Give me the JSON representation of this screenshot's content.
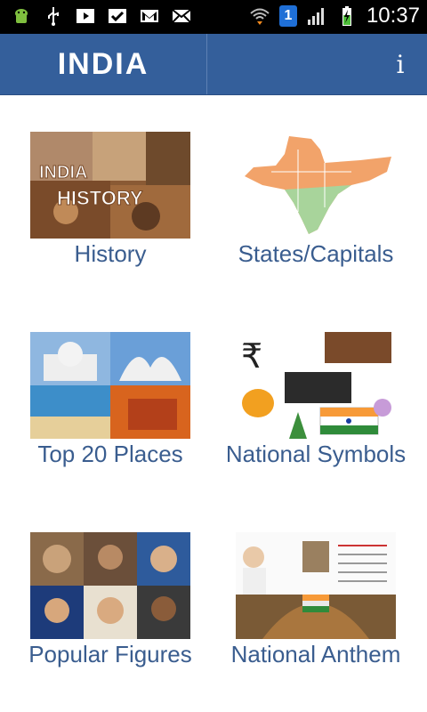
{
  "status_bar": {
    "time": "10:37",
    "sim_slot": "1",
    "left_icons": [
      "android-debug-icon",
      "usb-icon",
      "media-play-icon",
      "task-check-icon",
      "gmail-icon",
      "email-icon"
    ],
    "right_icons": [
      "wifi-icon",
      "sim-icon",
      "signal-icon",
      "battery-charging-icon"
    ]
  },
  "action_bar": {
    "title": "INDIA",
    "info_label": "i"
  },
  "menu": {
    "items": [
      {
        "label": "History"
      },
      {
        "label": "States/Capitals"
      },
      {
        "label": "Top 20 Places"
      },
      {
        "label": "National Symbols"
      },
      {
        "label": "Popular Figures"
      },
      {
        "label": "National Anthem"
      }
    ]
  },
  "thumb_text": {
    "history_line1": "INDIA",
    "history_line2": "HISTORY"
  },
  "colors": {
    "action_bar": "#345f9b",
    "label_text": "#3a5d8f",
    "status_bar": "#000000"
  }
}
